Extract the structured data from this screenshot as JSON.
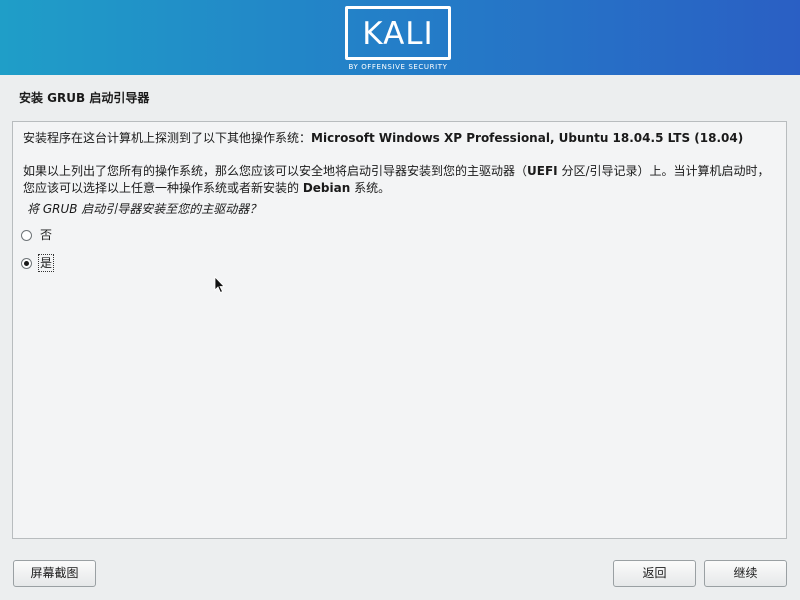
{
  "banner": {
    "logo_text": "KALI",
    "logo_subtitle": "BY OFFENSIVE SECURITY",
    "colors": {
      "gradient_start": "#1f9ec8",
      "gradient_end": "#2a5fc4"
    }
  },
  "page": {
    "title": "安装 GRUB 启动引导器"
  },
  "content": {
    "detected_prefix": "安装程序在这台计算机上探测到了以下其他操作系统：",
    "detected_systems": "Microsoft Windows XP Professional, Ubuntu 18.04.5 LTS (18.04)",
    "para1_part1": "如果以上列出了您所有的操作系统，那么您应该可以安全地将启动引导器安装到您的主驱动器（",
    "para1_bold": "UEFI",
    "para1_part2": " 分区/引导记录）上。当计算机启动时，",
    "para2_part1": "您应该可以选择以上任意一种操作系统或者新安装的 ",
    "para2_bold": "Debian",
    "para2_part2": " 系统。",
    "question": "将 GRUB 启动引导器安装至您的主驱动器？",
    "options": [
      {
        "label": "否",
        "selected": false
      },
      {
        "label": "是",
        "selected": true
      }
    ]
  },
  "buttons": {
    "screenshot": "屏幕截图",
    "back": "返回",
    "continue": "继续"
  }
}
